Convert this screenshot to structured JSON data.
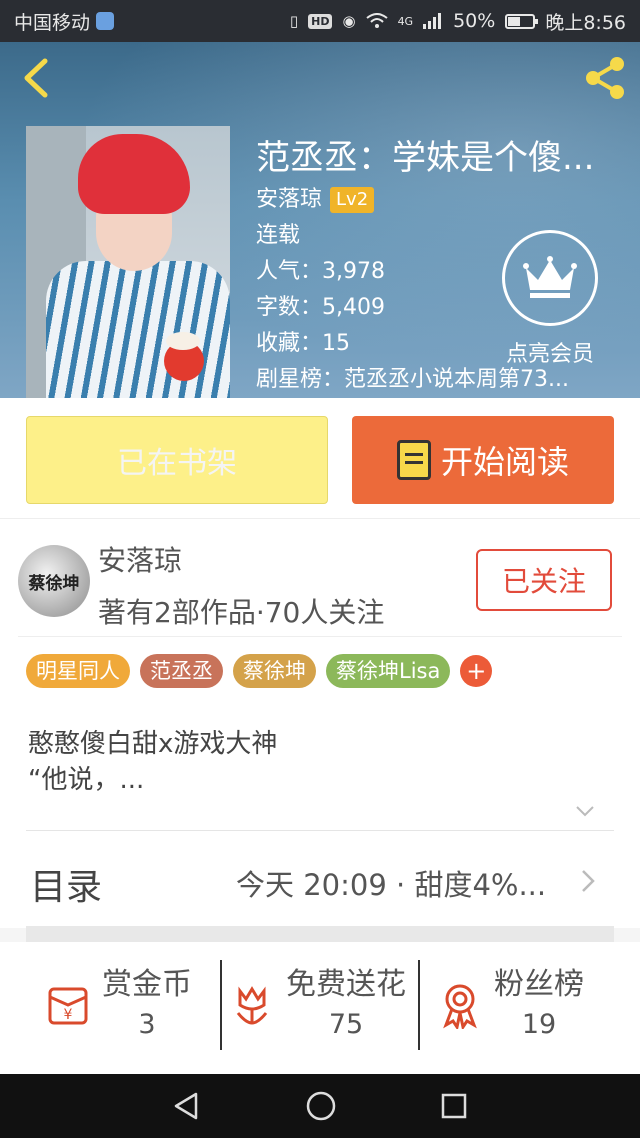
{
  "status_bar": {
    "carrier": "中国移动",
    "hd": "HD",
    "network": "4G",
    "battery_text": "50%",
    "battery_level": 0.5,
    "time": "晚上8:56"
  },
  "book": {
    "title": "范丞丞：学妹是个傻...",
    "author": "安落琼",
    "level": "Lv2",
    "status": "连载",
    "popularity": "人气：3,978",
    "word_count": "字数：5,409",
    "favorites": "收藏：15",
    "rank": "剧星榜：范丞丞小说本周第73..."
  },
  "vip": {
    "label": "点亮会员"
  },
  "actions": {
    "shelf_label": "已在书架",
    "read_label": "开始阅读"
  },
  "author_card": {
    "avatar_text": "蔡徐坤",
    "name": "安落琼",
    "meta": "著有2部作品·70人关注",
    "follow_label": "已关注"
  },
  "tags": [
    {
      "label": "明星同人",
      "color": "#f0a93a"
    },
    {
      "label": "范丞丞",
      "color": "#c8735a"
    },
    {
      "label": "蔡徐坤",
      "color": "#d4a24a"
    },
    {
      "label": "蔡徐坤Lisa",
      "color": "#8cb85a"
    }
  ],
  "tag_more": "+",
  "description": {
    "line1": "憨憨傻白甜x游戏大神",
    "line2": "“他说，..."
  },
  "catalog": {
    "label": "目录",
    "latest": "今天 20:09 · 甜度4%..."
  },
  "rewards": [
    {
      "label": "赏金币",
      "value": "3"
    },
    {
      "label": "免费送花",
      "value": "75"
    },
    {
      "label": "粉丝榜",
      "value": "19"
    }
  ],
  "colors": {
    "accent_orange": "#ec6a3a",
    "shelf_yellow": "#fdf089",
    "follow_red": "#e24b3b",
    "icon_red": "#d94a2c"
  }
}
